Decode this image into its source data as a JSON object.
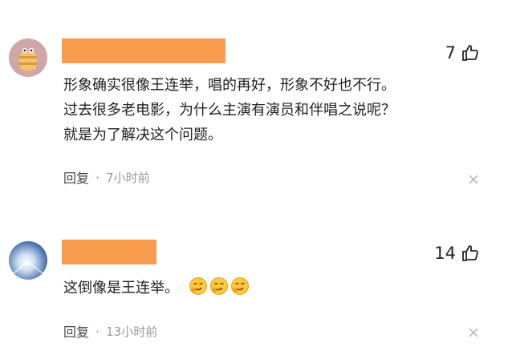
{
  "comments": [
    {
      "likes": "7",
      "lines": [
        "形象确实很像王连举，唱的再好，形象不好也不行。",
        "过去很多老电影，为什么主演有演员和伴唱之说呢？",
        "就是为了解决这个问题。"
      ],
      "reply_label": "回复",
      "separator": "·",
      "time": "7小时前"
    },
    {
      "likes": "14",
      "lines": [
        "这倒像是王连举。"
      ],
      "emojis": [
        "smirk-emoji",
        "smirk-emoji",
        "smirk-emoji"
      ],
      "reply_label": "回复",
      "separator": "·",
      "time": "13小时前"
    }
  ],
  "colors": {
    "name_redaction": "#f79b4d",
    "muted": "#999999",
    "text": "#1f1f1f"
  },
  "icons": {
    "like": "thumbs-up-icon",
    "close": "close-icon"
  }
}
